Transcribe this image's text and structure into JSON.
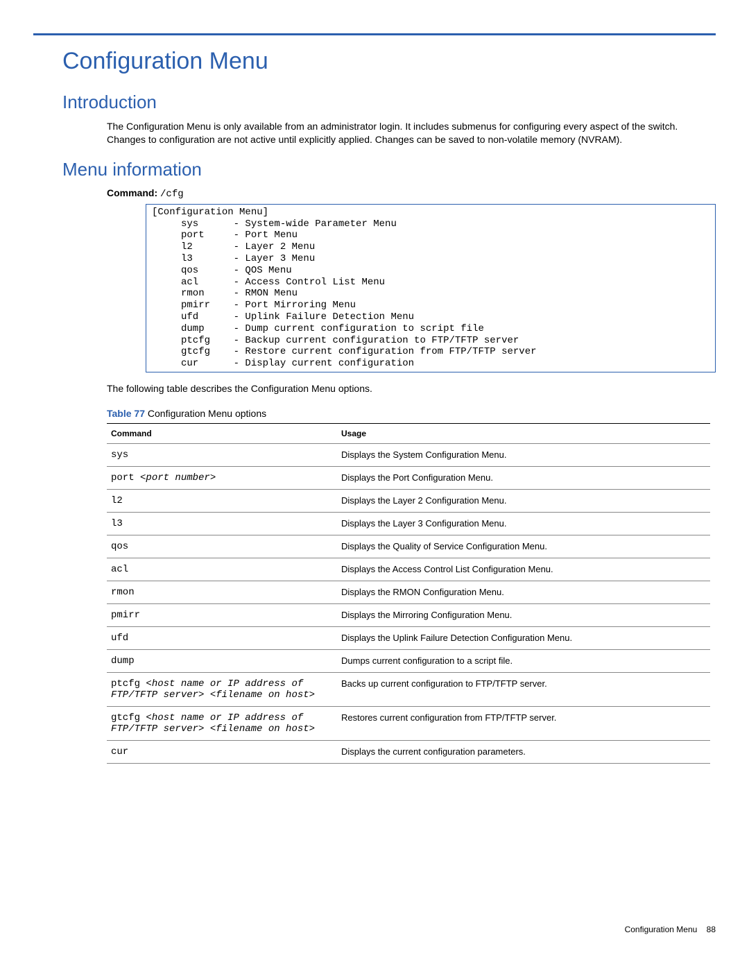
{
  "title": "Configuration Menu",
  "sections": {
    "intro": {
      "heading": "Introduction",
      "body": "The Configuration Menu is only available from an administrator login. It includes submenus for configuring every aspect of the switch. Changes to configuration are not active until explicitly applied. Changes can be saved to non-volatile memory (NVRAM)."
    },
    "menuinfo": {
      "heading": "Menu information",
      "command_label": "Command:",
      "command_value": "/cfg",
      "codebox": "[Configuration Menu]\n     sys      - System-wide Parameter Menu\n     port     - Port Menu\n     l2       - Layer 2 Menu\n     l3       - Layer 3 Menu\n     qos      - QOS Menu\n     acl      - Access Control List Menu\n     rmon     - RMON Menu\n     pmirr    - Port Mirroring Menu\n     ufd      - Uplink Failure Detection Menu\n     dump     - Dump current configuration to script file\n     ptcfg    - Backup current configuration to FTP/TFTP server\n     gtcfg    - Restore current configuration from FTP/TFTP server\n     cur      - Display current configuration",
      "followup": "The following table describes the Configuration Menu options.",
      "table_caption_num": "Table 77",
      "table_caption_text": " Configuration Menu options",
      "table": {
        "headers": {
          "c1": "Command",
          "c2": "Usage"
        },
        "rows": [
          {
            "cmd": "sys",
            "arg": "",
            "usage": "Displays the System Configuration Menu."
          },
          {
            "cmd": "port ",
            "arg": "<port number>",
            "usage": "Displays the Port Configuration Menu."
          },
          {
            "cmd": "l2",
            "arg": "",
            "usage": "Displays the Layer 2 Configuration Menu."
          },
          {
            "cmd": "l3",
            "arg": "",
            "usage": "Displays the Layer 3 Configuration Menu."
          },
          {
            "cmd": "qos",
            "arg": "",
            "usage": "Displays the Quality of Service Configuration Menu."
          },
          {
            "cmd": "acl",
            "arg": "",
            "usage": "Displays the Access Control List Configuration Menu."
          },
          {
            "cmd": "rmon",
            "arg": "",
            "usage": "Displays the RMON Configuration Menu."
          },
          {
            "cmd": "pmirr",
            "arg": "",
            "usage": "Displays the Mirroring Configuration Menu."
          },
          {
            "cmd": "ufd",
            "arg": "",
            "usage": "Displays the Uplink Failure Detection Configuration Menu."
          },
          {
            "cmd": "dump",
            "arg": "",
            "usage": "Dumps current configuration to a script file."
          },
          {
            "cmd": "ptcfg ",
            "arg": "<host name or IP address of FTP/TFTP server> <filename on host>",
            "usage": "Backs up current configuration to FTP/TFTP server."
          },
          {
            "cmd": "gtcfg ",
            "arg": "<host name or IP address of FTP/TFTP server> <filename on host>",
            "usage": "Restores current configuration from FTP/TFTP server."
          },
          {
            "cmd": "cur",
            "arg": "",
            "usage": "Displays the current configuration parameters."
          }
        ]
      }
    }
  },
  "footer": {
    "text": "Configuration Menu",
    "page": "88"
  }
}
